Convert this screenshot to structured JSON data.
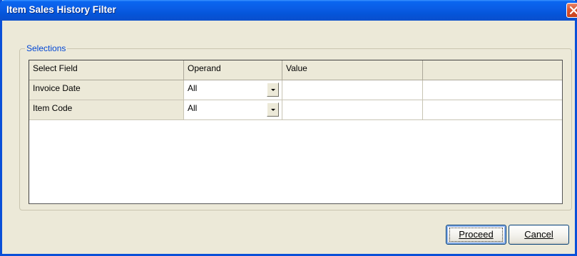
{
  "window": {
    "title": "Item Sales History Filter"
  },
  "selections": {
    "group_label": "Selections",
    "columns": [
      "Select Field",
      "Operand",
      "Value",
      ""
    ],
    "rows": [
      {
        "field": "Invoice Date",
        "operand": "All",
        "value": "",
        "extra": ""
      },
      {
        "field": "Item Code",
        "operand": "All",
        "value": "",
        "extra": ""
      }
    ]
  },
  "buttons": {
    "proceed_label": "Proceed",
    "cancel_label": "Cancel"
  },
  "colors": {
    "titlebar": "#0a5de6",
    "group_label": "#0046d5",
    "close_button": "#d9532e"
  }
}
